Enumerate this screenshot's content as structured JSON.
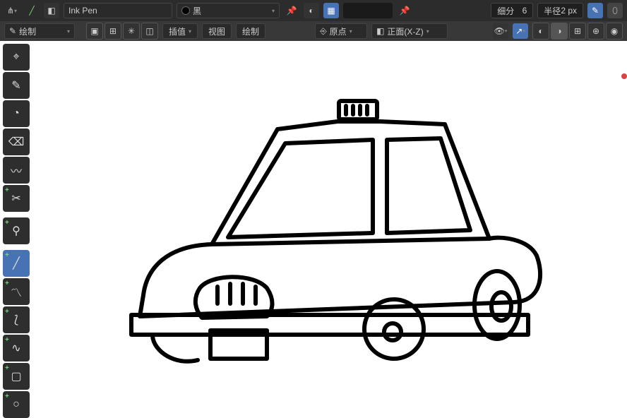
{
  "top": {
    "brush_label": "Ink Pen",
    "color_label": "黑",
    "subdiv_label": "细分",
    "subdiv_value": "6",
    "radius_label": "半径",
    "radius_value": "2 px"
  },
  "top2": {
    "mode": "绘制",
    "interp": "插值",
    "view": "视图",
    "draw": "绘制",
    "origin": "原点",
    "front": "正面(X-Z)"
  },
  "cursor_icon": "⌖",
  "pencil_icon": "✎",
  "fill_icon": "◔",
  "erase_icon": "⌫",
  "curve_icon": "〰",
  "cut_icon": "✂",
  "eyedrop_icon": "⚲",
  "line_icon": "╱",
  "poly_icon": "〽",
  "arc_icon": "⟅",
  "bez_icon": "∿",
  "box_icon": "▢",
  "circ_icon": "○"
}
